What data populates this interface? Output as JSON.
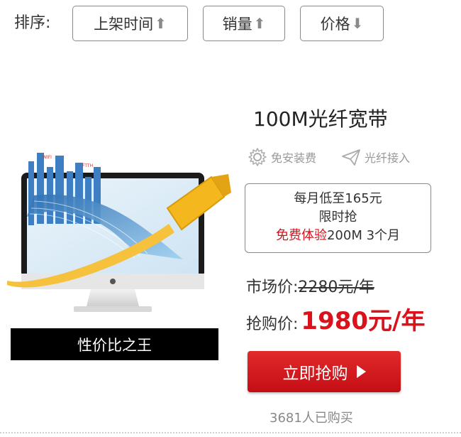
{
  "sort": {
    "label": "排序:",
    "buttons": [
      {
        "label": "上架时间",
        "arrow": "⬆"
      },
      {
        "label": "销量",
        "arrow": "⬆"
      },
      {
        "label": "价格",
        "arrow": "⬇"
      }
    ]
  },
  "product": {
    "title": "100M光纤宽带",
    "banner": "性价比之王",
    "features": [
      {
        "icon": "gear-icon",
        "label": "免安装费"
      },
      {
        "icon": "paper-plane-icon",
        "label": "光纤接入"
      }
    ],
    "promo": {
      "line1": "每月低至165元",
      "line2": "限时抢",
      "line3_red": "免费体验",
      "line3_rest": "200M 3个月"
    },
    "market_price_label": "市场价:",
    "market_price": "2280元/年",
    "rush_price_label": "抢购价:",
    "rush_price": "1980元/年",
    "buy_button": "立即抢购",
    "sold_text": "3681人已购买",
    "image_labels": {
      "wifi": "WIFI",
      "ftth": "FTTH"
    }
  },
  "colors": {
    "accent_red": "#d9121b",
    "border_gray": "#8a8a8a"
  }
}
